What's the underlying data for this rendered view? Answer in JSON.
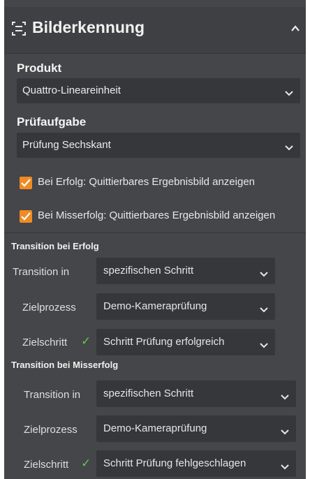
{
  "header": {
    "title": "Bilderkennung",
    "icon": "image-recognition-icon",
    "collapse_icon": "chevron-up-icon"
  },
  "produkt": {
    "label": "Produkt",
    "value": "Quattro-Lineareinheit"
  },
  "pruefaufgabe": {
    "label": "Prüfaufgabe",
    "value": "Prüfung Sechskant"
  },
  "checkboxes": [
    {
      "label": "Bei Erfolg: Quittierbares Ergebnisbild anzeigen",
      "checked": true
    },
    {
      "label": "Bei Misserfolg: Quittierbares Ergebnisbild anzeigen",
      "checked": true
    }
  ],
  "transition_success": {
    "title": "Transition bei Erfolg",
    "transition_in_label": "Transition in",
    "transition_in_value": "spezifischen Schritt",
    "zielprozess_label": "Zielprozess",
    "zielprozess_value": "Demo-Kameraprüfung",
    "zielschritt_label": "Zielschritt",
    "zielschritt_value": "Schritt Prüfung erfolgreich",
    "tick": "✓"
  },
  "transition_failure": {
    "title": "Transition bei Misserfolg",
    "transition_in_label": "Transition in",
    "transition_in_value": "spezifischen Schritt",
    "zielprozess_label": "Zielprozess",
    "zielprozess_value": "Demo-Kameraprüfung",
    "zielschritt_label": "Zielschritt",
    "zielschritt_value": "Schritt Prüfung fehlgeschlagen",
    "tick": "✓"
  },
  "colors": {
    "panel": "#444649",
    "field": "#35373a",
    "checkbox": "#f08a23",
    "tick": "#63c553"
  }
}
